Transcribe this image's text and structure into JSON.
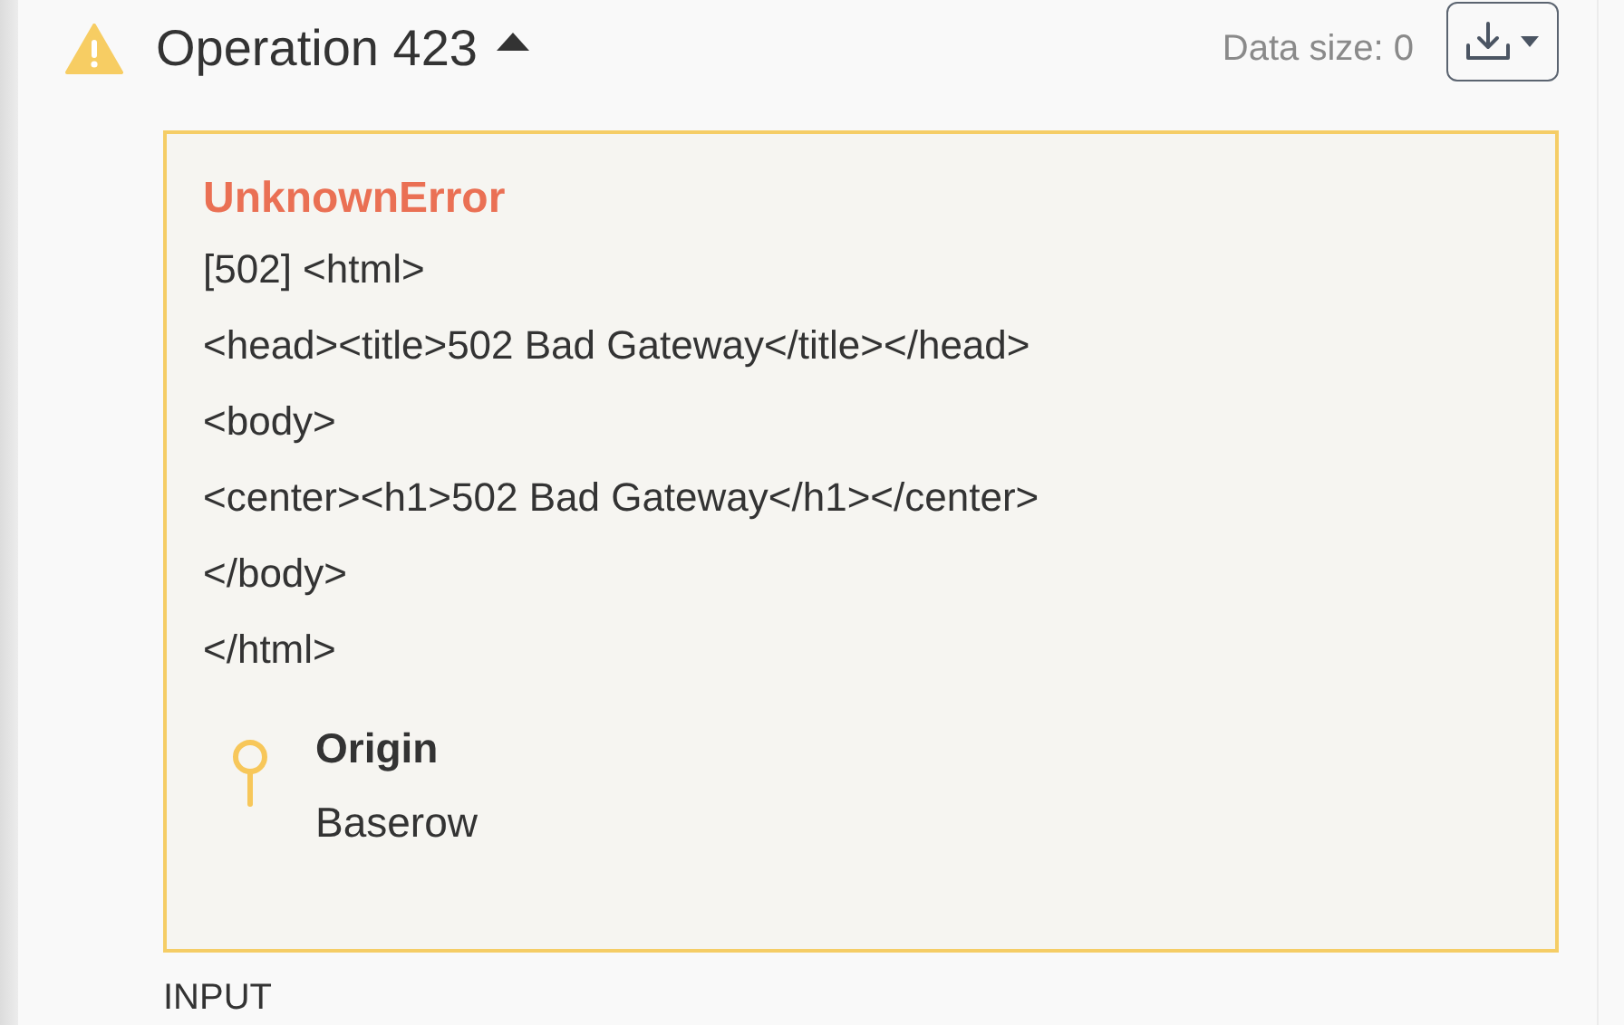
{
  "operation": {
    "title": "Operation 423",
    "expanded": true,
    "data_size": "Data size: 0"
  },
  "error": {
    "type": "UnknownError",
    "message": "[502] <html>\n<head><title>502 Bad Gateway</title></head>\n<body>\n<center><h1>502 Bad Gateway</h1></center>\n</body>\n</html>",
    "origin_label": "Origin",
    "origin": "Baserow"
  },
  "next_section": "INPUT"
}
